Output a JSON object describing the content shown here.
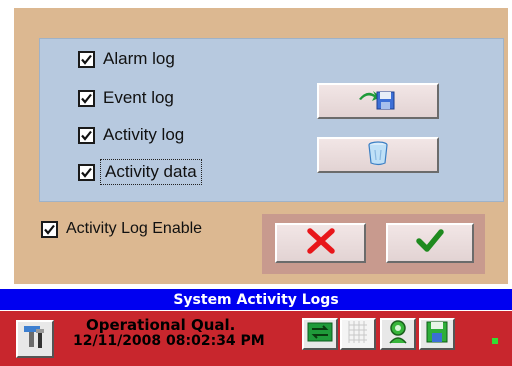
{
  "dialog": {
    "log_options": [
      {
        "label": "Alarm log",
        "checked": true
      },
      {
        "label": "Event log",
        "checked": true
      },
      {
        "label": "Activity log",
        "checked": true
      },
      {
        "label": "Activity data",
        "checked": true
      }
    ],
    "activity_log_enable": {
      "label": "Activity Log Enable",
      "checked": true
    },
    "export_button_icon": "save-to-disk-icon",
    "delete_button_icon": "trash-bin-icon",
    "cancel_icon": "red-x-icon",
    "ok_icon": "green-checkmark-icon"
  },
  "status_bar": {
    "title": "System Activity Logs"
  },
  "taskbar": {
    "mode": "Operational Qual.",
    "datetime": "12/11/2008 08:02:34 PM",
    "icons": [
      "tools-icon",
      "network-icon",
      "grid-icon",
      "person-icon",
      "save-icon",
      "status-led-icon"
    ]
  },
  "colors": {
    "dialog_bg": "#dcb891",
    "inner_panel": "#b7c9df",
    "status_bar": "#0000f0",
    "taskbar": "#c8262d",
    "cancel_red": "#e8161a",
    "ok_green": "#1f8a1f",
    "led_green": "#33dd33"
  }
}
